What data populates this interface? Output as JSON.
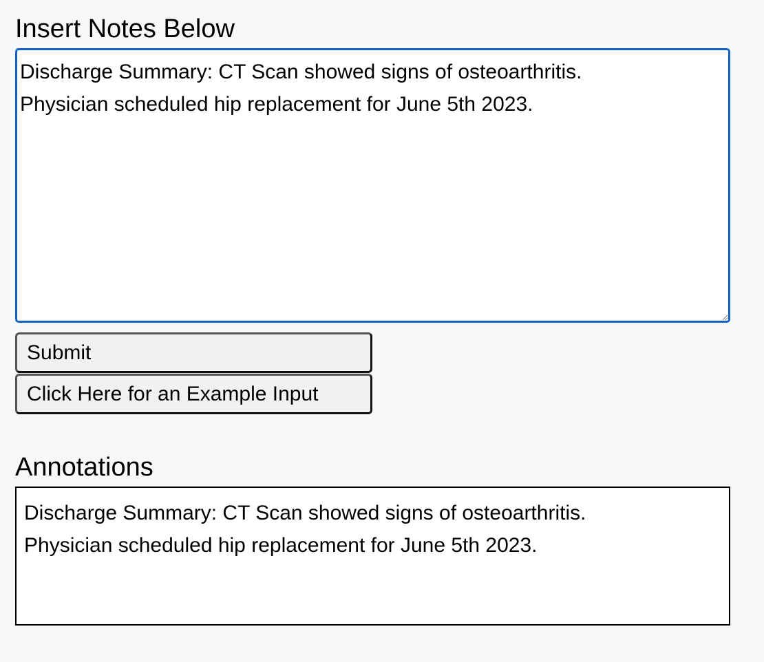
{
  "notes_section": {
    "label": "Insert Notes Below",
    "value": "Discharge Summary: CT Scan showed signs of osteoarthritis.\nPhysician scheduled hip replacement for June 5th 2023."
  },
  "buttons": {
    "submit_label": "Submit",
    "example_label": "Click Here for an Example Input"
  },
  "annotations_section": {
    "label": "Annotations",
    "lines": [
      "Discharge Summary: CT Scan showed signs of osteoarthritis.",
      "Physician scheduled hip replacement for June 5th 2023."
    ]
  },
  "colors": {
    "page_background": "#f7f8fa",
    "focus_border": "#1662c4",
    "button_background": "#f3f1f0"
  }
}
